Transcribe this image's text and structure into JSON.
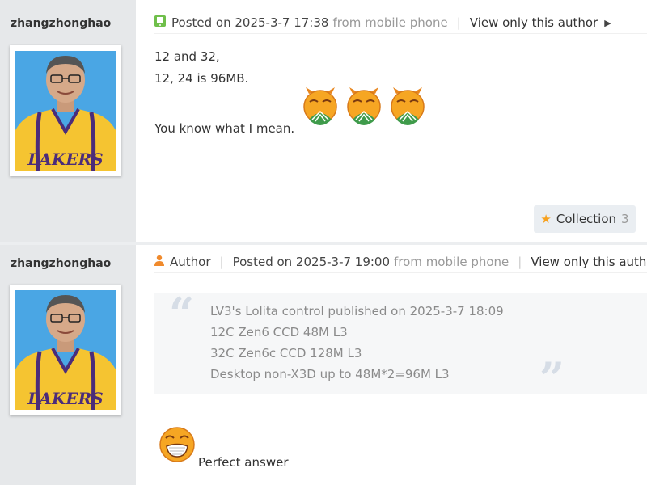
{
  "posts": [
    {
      "author": "zhangzhonghao",
      "meta": {
        "posted": "Posted on 2025-3-7 17:38",
        "source": "from mobile phone",
        "view_only": "View only this author"
      },
      "lines": [
        "12 and 32,",
        "12, 24 is 96MB.",
        "You know what I mean."
      ],
      "collection": {
        "label": "Collection",
        "count": "3"
      }
    },
    {
      "author": "zhangzhonghao",
      "meta": {
        "author_badge": "Author",
        "posted": "Posted on 2025-3-7 19:00",
        "source": "from mobile phone",
        "view_only": "View only this author"
      },
      "quote": [
        "LV3's Lolita control published on 2025-3-7 18:09",
        "12C Zen6 CCD 48M L3",
        "32C Zen6c CCD 128M L3",
        "Desktop non-X3D up to 48M*2=96M L3"
      ],
      "reply": "Perfect answer"
    }
  ],
  "avatar_text": "LAKERS",
  "colors": {
    "sidebar": "#e6e8ea",
    "star": "#f7a11e",
    "author_icon": "#f08a2c",
    "quote_bg": "#f6f7f8",
    "jersey": "#f5c431",
    "avatar_bg": "#4aa6e4"
  },
  "icons": [
    "phone-icon",
    "person-icon",
    "caret-right-icon",
    "star-icon",
    "emoji-icon",
    "quote-mark-icon"
  ]
}
